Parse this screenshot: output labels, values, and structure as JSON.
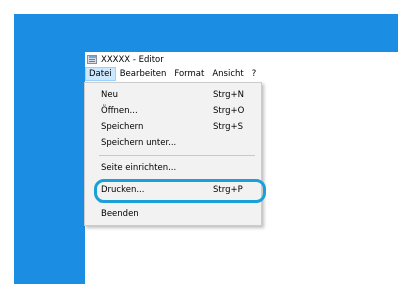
{
  "window": {
    "title": "XXXXX - Editor",
    "icon": "notepad-icon"
  },
  "menubar": {
    "items": [
      "Datei",
      "Bearbeiten",
      "Format",
      "Ansicht",
      "?"
    ]
  },
  "dropdown": {
    "items": [
      {
        "label": "Neu",
        "shortcut": "Strg+N"
      },
      {
        "label": "Öffnen...",
        "shortcut": "Strg+O"
      },
      {
        "label": "Speichern",
        "shortcut": "Strg+S"
      },
      {
        "label": "Speichern unter...",
        "shortcut": ""
      },
      {
        "label": "Seite einrichten...",
        "shortcut": ""
      },
      {
        "label": "Drucken...",
        "shortcut": "Strg+P"
      },
      {
        "label": "Beenden",
        "shortcut": ""
      }
    ]
  },
  "colors": {
    "desktop": "#1b8ee3",
    "highlight_ring": "#1aa0d8",
    "active_menu": "#cce8ff"
  }
}
